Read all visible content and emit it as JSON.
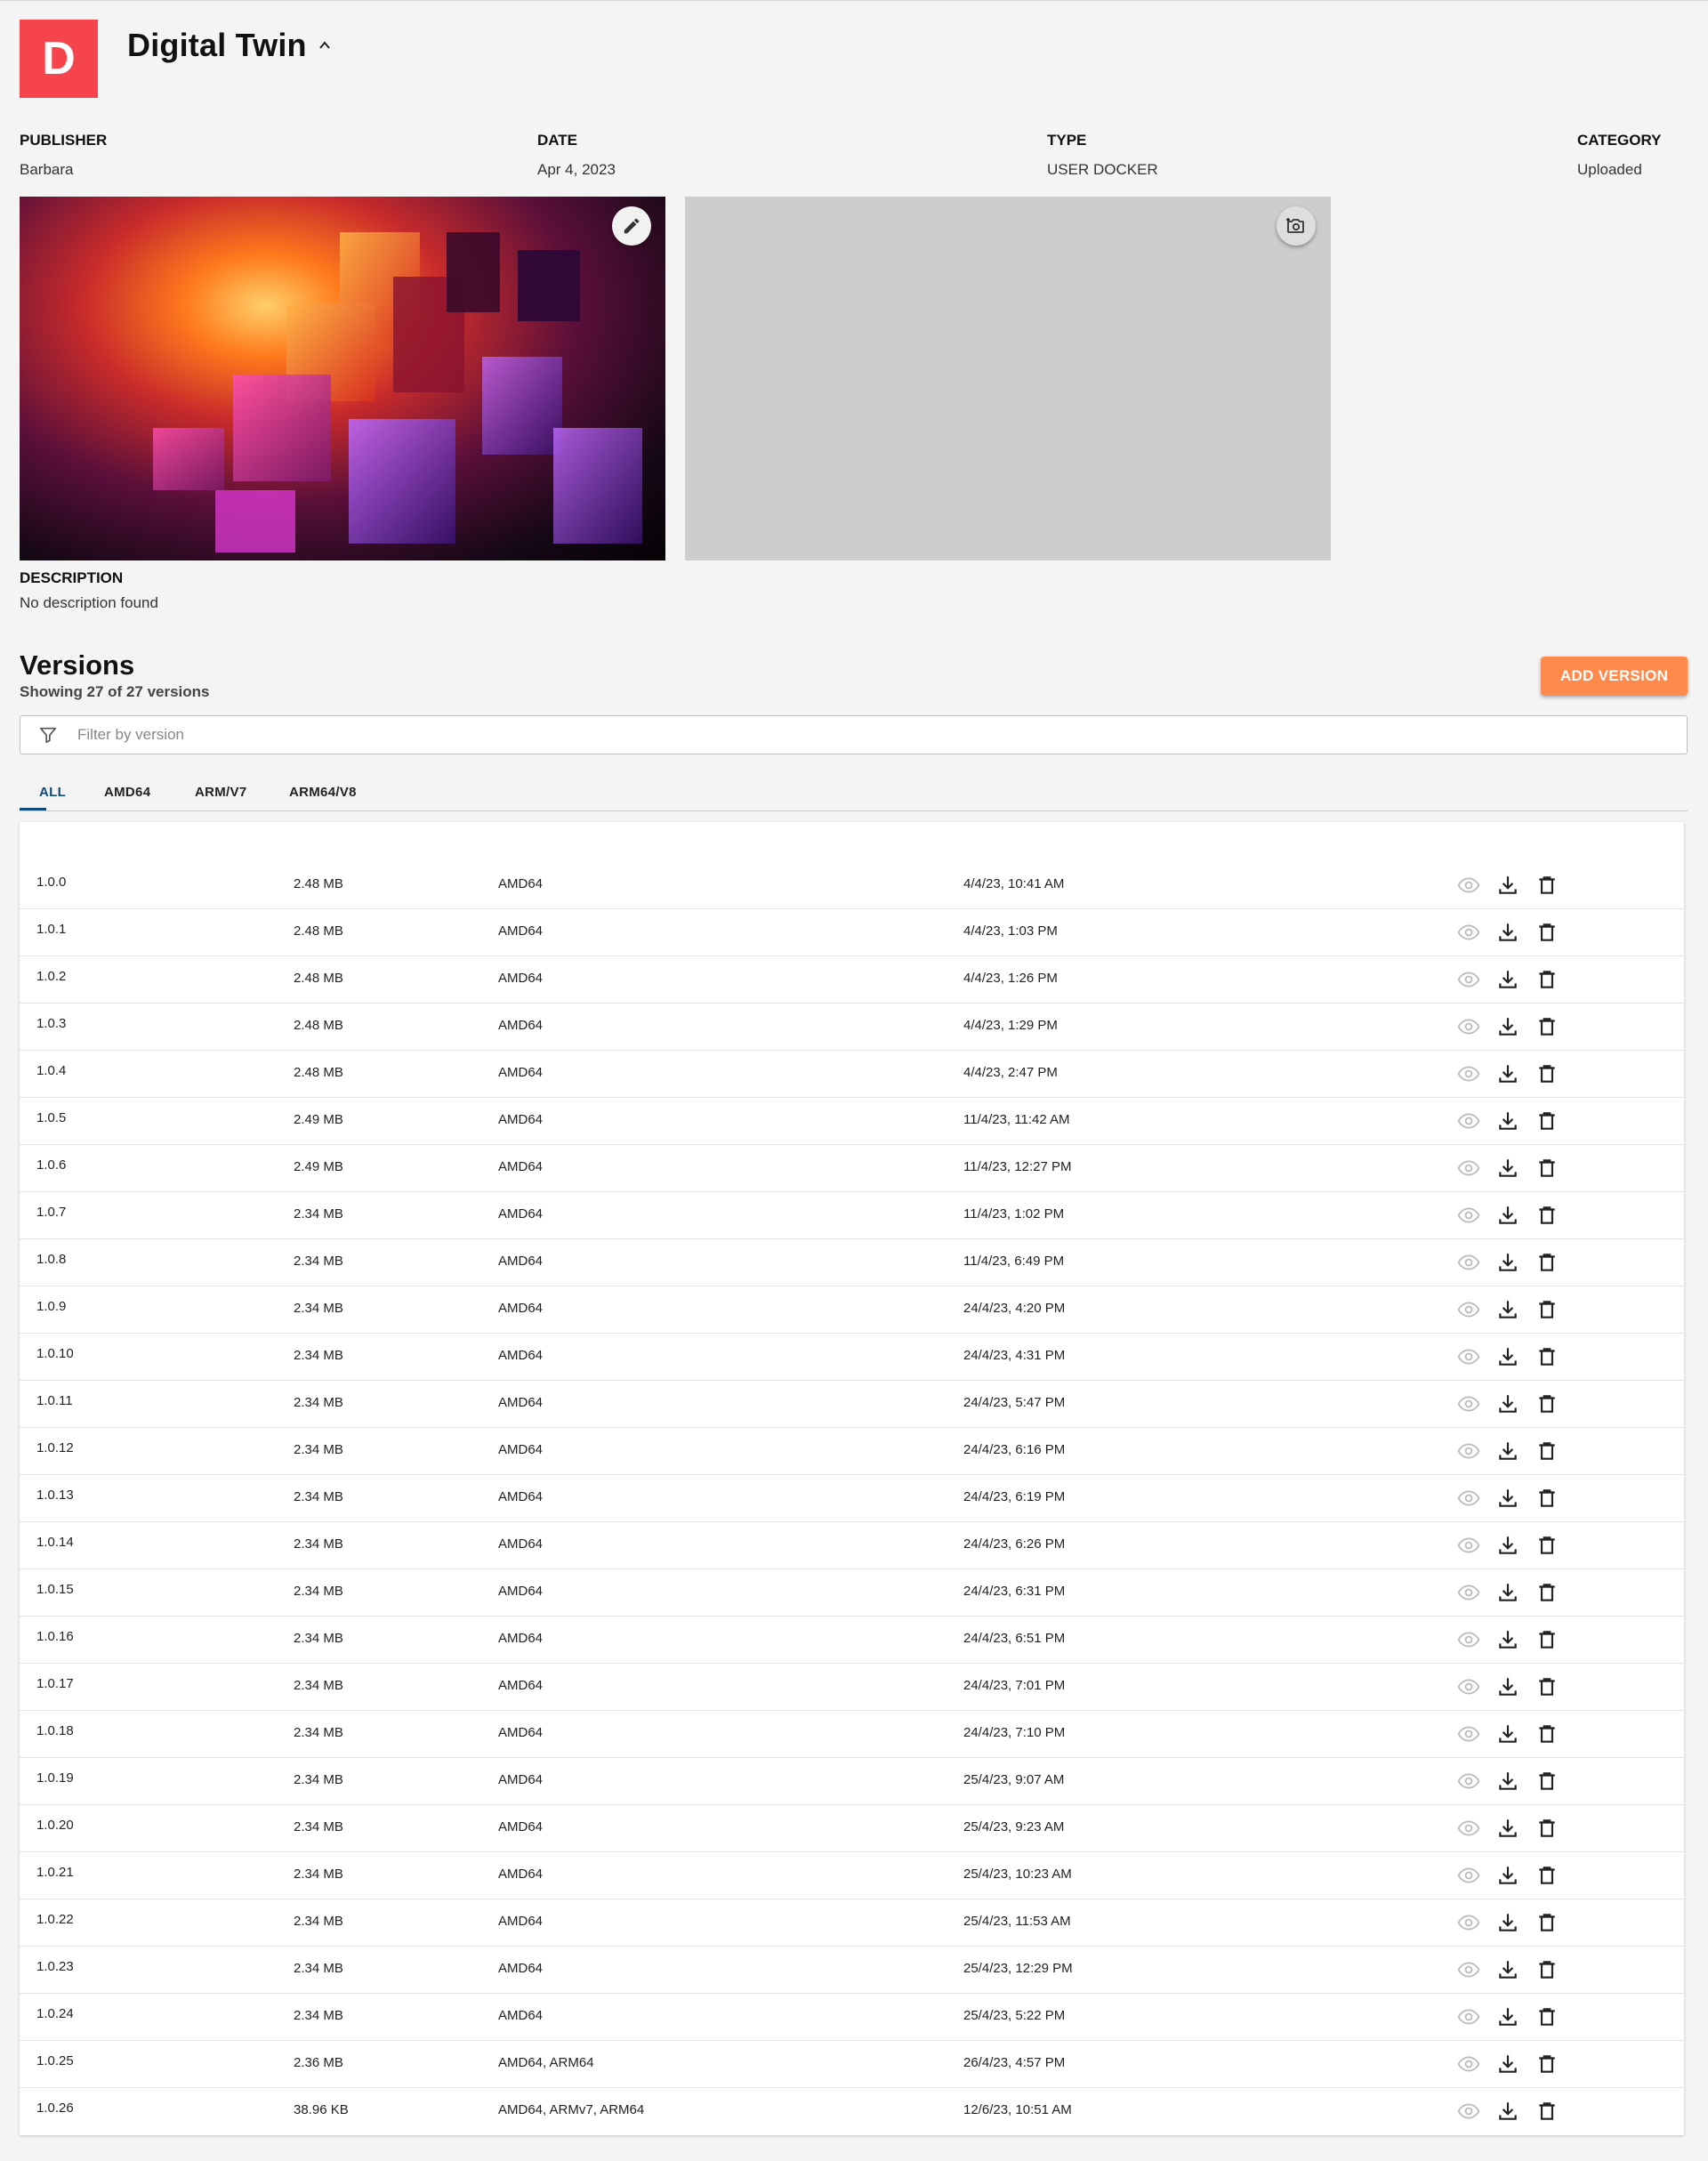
{
  "app": {
    "logo_letter": "D",
    "title": "Digital Twin"
  },
  "meta": {
    "publisher_label": "PUBLISHER",
    "publisher": "Barbara",
    "date_label": "DATE",
    "date": "Apr 4, 2023",
    "type_label": "TYPE",
    "type": "USER DOCKER",
    "category_label": "CATEGORY",
    "category": "Uploaded"
  },
  "description": {
    "label": "DESCRIPTION",
    "value": "No description found"
  },
  "versions": {
    "title": "Versions",
    "subtitle": "Showing 27 of 27 versions",
    "add_label": "ADD VERSION",
    "filter_placeholder": "Filter by version",
    "tabs": [
      "ALL",
      "AMD64",
      "ARM/V7",
      "ARM64/V8"
    ],
    "active_tab": "ALL",
    "rows": [
      {
        "version": "1.0.0",
        "size": "2.48 MB",
        "arch": "AMD64",
        "date": "4/4/23, 10:41 AM"
      },
      {
        "version": "1.0.1",
        "size": "2.48 MB",
        "arch": "AMD64",
        "date": "4/4/23, 1:03 PM"
      },
      {
        "version": "1.0.2",
        "size": "2.48 MB",
        "arch": "AMD64",
        "date": "4/4/23, 1:26 PM"
      },
      {
        "version": "1.0.3",
        "size": "2.48 MB",
        "arch": "AMD64",
        "date": "4/4/23, 1:29 PM"
      },
      {
        "version": "1.0.4",
        "size": "2.48 MB",
        "arch": "AMD64",
        "date": "4/4/23, 2:47 PM"
      },
      {
        "version": "1.0.5",
        "size": "2.49 MB",
        "arch": "AMD64",
        "date": "11/4/23, 11:42 AM"
      },
      {
        "version": "1.0.6",
        "size": "2.49 MB",
        "arch": "AMD64",
        "date": "11/4/23, 12:27 PM"
      },
      {
        "version": "1.0.7",
        "size": "2.34 MB",
        "arch": "AMD64",
        "date": "11/4/23, 1:02 PM"
      },
      {
        "version": "1.0.8",
        "size": "2.34 MB",
        "arch": "AMD64",
        "date": "11/4/23, 6:49 PM"
      },
      {
        "version": "1.0.9",
        "size": "2.34 MB",
        "arch": "AMD64",
        "date": "24/4/23, 4:20 PM"
      },
      {
        "version": "1.0.10",
        "size": "2.34 MB",
        "arch": "AMD64",
        "date": "24/4/23, 4:31 PM"
      },
      {
        "version": "1.0.11",
        "size": "2.34 MB",
        "arch": "AMD64",
        "date": "24/4/23, 5:47 PM"
      },
      {
        "version": "1.0.12",
        "size": "2.34 MB",
        "arch": "AMD64",
        "date": "24/4/23, 6:16 PM"
      },
      {
        "version": "1.0.13",
        "size": "2.34 MB",
        "arch": "AMD64",
        "date": "24/4/23, 6:19 PM"
      },
      {
        "version": "1.0.14",
        "size": "2.34 MB",
        "arch": "AMD64",
        "date": "24/4/23, 6:26 PM"
      },
      {
        "version": "1.0.15",
        "size": "2.34 MB",
        "arch": "AMD64",
        "date": "24/4/23, 6:31 PM"
      },
      {
        "version": "1.0.16",
        "size": "2.34 MB",
        "arch": "AMD64",
        "date": "24/4/23, 6:51 PM"
      },
      {
        "version": "1.0.17",
        "size": "2.34 MB",
        "arch": "AMD64",
        "date": "24/4/23, 7:01 PM"
      },
      {
        "version": "1.0.18",
        "size": "2.34 MB",
        "arch": "AMD64",
        "date": "24/4/23, 7:10 PM"
      },
      {
        "version": "1.0.19",
        "size": "2.34 MB",
        "arch": "AMD64",
        "date": "25/4/23, 9:07 AM"
      },
      {
        "version": "1.0.20",
        "size": "2.34 MB",
        "arch": "AMD64",
        "date": "25/4/23, 9:23 AM"
      },
      {
        "version": "1.0.21",
        "size": "2.34 MB",
        "arch": "AMD64",
        "date": "25/4/23, 10:23 AM"
      },
      {
        "version": "1.0.22",
        "size": "2.34 MB",
        "arch": "AMD64",
        "date": "25/4/23, 11:53 AM"
      },
      {
        "version": "1.0.23",
        "size": "2.34 MB",
        "arch": "AMD64",
        "date": "25/4/23, 12:29 PM"
      },
      {
        "version": "1.0.24",
        "size": "2.34 MB",
        "arch": "AMD64",
        "date": "25/4/23, 5:22 PM"
      },
      {
        "version": "1.0.25",
        "size": "2.36 MB",
        "arch": "AMD64, ARM64",
        "date": "26/4/23, 4:57 PM"
      },
      {
        "version": "1.0.26",
        "size": "38.96 KB",
        "arch": "AMD64, ARMv7, ARM64",
        "date": "12/6/23, 10:51 AM"
      }
    ]
  },
  "icons": {
    "title_toggle": "chevron-up-icon",
    "edit_image": "pencil-icon",
    "add_image": "camera-add-icon",
    "filter": "filter-funnel-icon",
    "row_actions": [
      "eye-icon",
      "download-icon",
      "trash-icon"
    ]
  },
  "colors": {
    "brand": "#f5444b",
    "accent": "#ff8a4c",
    "tab_active": "#0e4a78"
  }
}
